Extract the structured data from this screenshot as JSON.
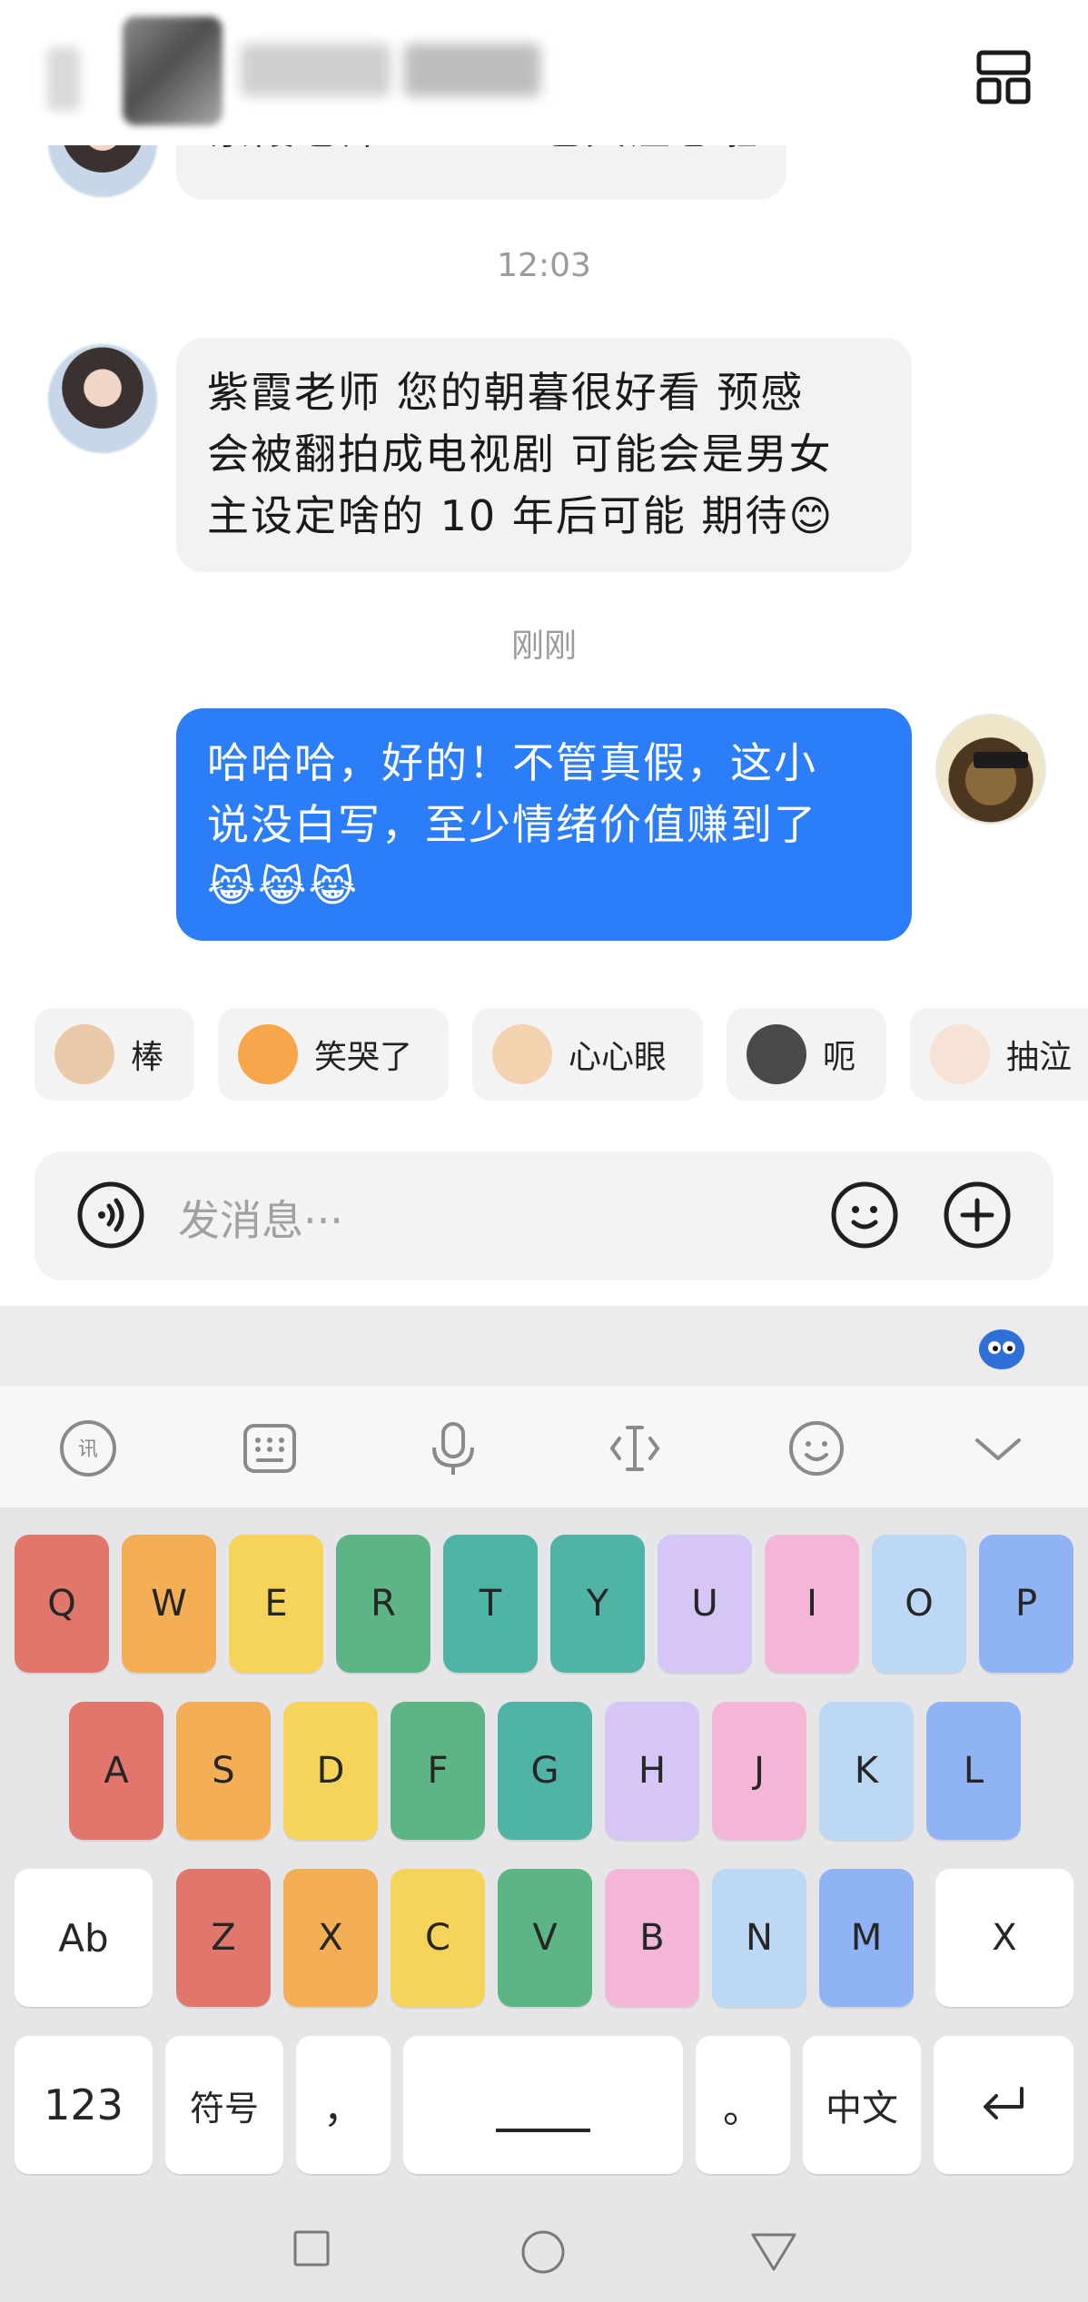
{
  "header": {
    "menu_icon": "layout-grid-icon"
  },
  "chat": {
    "top_partial_message": "紫霞老师 forter 也关注您啦",
    "timestamp_1": "12:03",
    "message_1": [
      "紫霞老师 您的朝暮很好看 预感",
      "会被翻拍成电视剧 可能会是男女",
      "主设定啥的 10 年后可能 期待😊"
    ],
    "timestamp_2": "刚刚",
    "message_2": [
      "哈哈哈，好的！不管真假，这小",
      "说没白写，至少情绪价值赚到了",
      "😹😹😹"
    ]
  },
  "quick_reactions": [
    {
      "label": "棒",
      "color": "#e9c9a8"
    },
    {
      "label": "笑哭了",
      "color": "#f7a64a"
    },
    {
      "label": "心心眼",
      "color": "#f3d2b0"
    },
    {
      "label": "呃",
      "color": "#4a4a4a"
    },
    {
      "label": "抽泣",
      "color": "#f7e3d6"
    }
  ],
  "input": {
    "placeholder": "发消息···",
    "voice_icon": "voice-icon",
    "emoji_icon": "emoji-icon",
    "plus_icon": "plus-icon"
  },
  "keyboard": {
    "toolbar_icons": [
      "ime-logo-icon",
      "keyboard-icon",
      "microphone-icon",
      "cursor-icon",
      "emoji-icon",
      "collapse-icon"
    ],
    "row1": [
      {
        "label": "Q",
        "color": "#e1776c"
      },
      {
        "label": "W",
        "color": "#f4ae55"
      },
      {
        "label": "E",
        "color": "#f6d45a"
      },
      {
        "label": "R",
        "color": "#5db585"
      },
      {
        "label": "T",
        "color": "#4fb3a5"
      },
      {
        "label": "Y",
        "color": "#4fb3a5"
      },
      {
        "label": "U",
        "color": "#d6c6f6"
      },
      {
        "label": "I",
        "color": "#f4b6d6"
      },
      {
        "label": "O",
        "color": "#bcd8f4"
      },
      {
        "label": "P",
        "color": "#8fb3f4"
      }
    ],
    "row2": [
      {
        "label": "A",
        "color": "#e1776c"
      },
      {
        "label": "S",
        "color": "#f4ae55"
      },
      {
        "label": "D",
        "color": "#f6d45a"
      },
      {
        "label": "F",
        "color": "#5db585"
      },
      {
        "label": "G",
        "color": "#4fb3a5"
      },
      {
        "label": "H",
        "color": "#d6c6f6"
      },
      {
        "label": "J",
        "color": "#f4b6d6"
      },
      {
        "label": "K",
        "color": "#bcd8f4"
      },
      {
        "label": "L",
        "color": "#8fb3f4"
      }
    ],
    "row3": [
      {
        "label": "Ab",
        "color": "#ffffff"
      },
      {
        "label": "Z",
        "color": "#e1776c"
      },
      {
        "label": "X",
        "color": "#f4ae55"
      },
      {
        "label": "C",
        "color": "#f6d45a"
      },
      {
        "label": "V",
        "color": "#5db585"
      },
      {
        "label": "B",
        "color": "#f4b6d6"
      },
      {
        "label": "N",
        "color": "#bcd8f4"
      },
      {
        "label": "M",
        "color": "#8fb3f4"
      },
      {
        "label": "X",
        "color": "#ffffff"
      }
    ],
    "row4": [
      {
        "label": "123"
      },
      {
        "label": "符号"
      },
      {
        "label": "，"
      },
      {
        "label": "space"
      },
      {
        "label": "。"
      },
      {
        "label": "中文"
      },
      {
        "label": "enter"
      }
    ]
  },
  "nav": [
    "square-icon",
    "circle-icon",
    "triangle-icon"
  ]
}
